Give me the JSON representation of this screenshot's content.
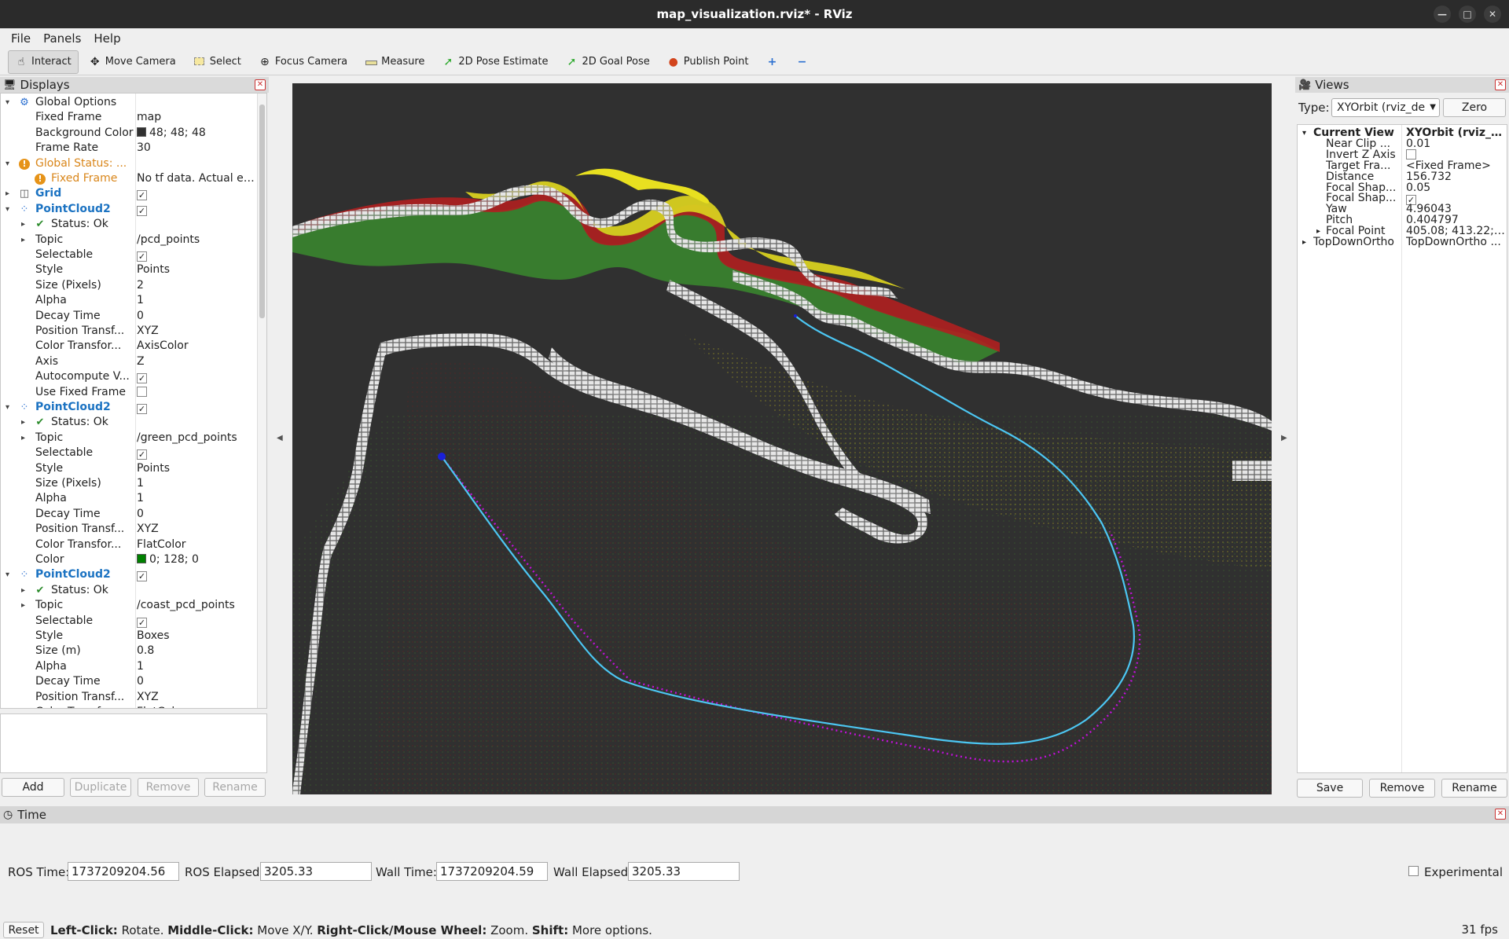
{
  "window": {
    "title": "map_visualization.rviz* - RViz"
  },
  "menu": [
    "File",
    "Panels",
    "Help"
  ],
  "toolbar": [
    {
      "label": "Interact",
      "icon": "cursor-icon"
    },
    {
      "label": "Move Camera",
      "icon": "move-camera-icon"
    },
    {
      "label": "Select",
      "icon": "select-icon"
    },
    {
      "label": "Focus Camera",
      "icon": "focus-camera-icon"
    },
    {
      "label": "Measure",
      "icon": "measure-icon"
    },
    {
      "label": "2D Pose Estimate",
      "icon": "pose-estimate-icon"
    },
    {
      "label": "2D Goal Pose",
      "icon": "goal-pose-icon"
    },
    {
      "label": "Publish Point",
      "icon": "publish-point-icon"
    }
  ],
  "displays": {
    "title": "Displays",
    "rows": [
      {
        "name": "Global Options",
        "value": "",
        "indent": 0,
        "arrow": "down",
        "icon": "gear",
        "style": ""
      },
      {
        "name": "Fixed Frame",
        "value": "map",
        "indent": 1,
        "style": ""
      },
      {
        "name": "Background Color",
        "value": "48; 48; 48",
        "indent": 1,
        "swatch": "#303030",
        "style": ""
      },
      {
        "name": "Frame Rate",
        "value": "30",
        "indent": 1,
        "style": ""
      },
      {
        "name": "Global Status: ...",
        "value": "",
        "indent": 0,
        "arrow": "down",
        "icon": "warn",
        "style": "orange"
      },
      {
        "name": "Fixed Frame",
        "value": "No tf data.  Actual err...",
        "indent": 1,
        "icon": "warn",
        "style": "orange"
      },
      {
        "name": "Grid",
        "value": "",
        "indent": 0,
        "arrow": "right",
        "icon": "grid",
        "style": "blue",
        "check": true
      },
      {
        "name": "PointCloud2",
        "value": "",
        "indent": 0,
        "arrow": "down",
        "icon": "cloud",
        "style": "blue",
        "check": true
      },
      {
        "name": "Status: Ok",
        "value": "",
        "indent": 1,
        "arrow": "right",
        "icon": "ok",
        "style": ""
      },
      {
        "name": "Topic",
        "value": "/pcd_points",
        "indent": 1,
        "arrow": "right",
        "style": ""
      },
      {
        "name": "Selectable",
        "value": "",
        "indent": 1,
        "check": true,
        "style": ""
      },
      {
        "name": "Style",
        "value": "Points",
        "indent": 1,
        "style": ""
      },
      {
        "name": "Size (Pixels)",
        "value": "2",
        "indent": 1,
        "style": ""
      },
      {
        "name": "Alpha",
        "value": "1",
        "indent": 1,
        "style": ""
      },
      {
        "name": "Decay Time",
        "value": "0",
        "indent": 1,
        "style": ""
      },
      {
        "name": "Position Transf...",
        "value": "XYZ",
        "indent": 1,
        "style": ""
      },
      {
        "name": "Color Transfor...",
        "value": "AxisColor",
        "indent": 1,
        "style": ""
      },
      {
        "name": "Axis",
        "value": "Z",
        "indent": 1,
        "style": ""
      },
      {
        "name": "Autocompute V...",
        "value": "",
        "indent": 1,
        "check": true,
        "style": ""
      },
      {
        "name": "Use Fixed Frame",
        "value": "",
        "indent": 1,
        "check": false,
        "style": ""
      },
      {
        "name": "PointCloud2",
        "value": "",
        "indent": 0,
        "arrow": "down",
        "icon": "cloud",
        "style": "blue",
        "check": true
      },
      {
        "name": "Status: Ok",
        "value": "",
        "indent": 1,
        "arrow": "right",
        "icon": "ok",
        "style": ""
      },
      {
        "name": "Topic",
        "value": "/green_pcd_points",
        "indent": 1,
        "arrow": "right",
        "style": ""
      },
      {
        "name": "Selectable",
        "value": "",
        "indent": 1,
        "check": true,
        "style": ""
      },
      {
        "name": "Style",
        "value": "Points",
        "indent": 1,
        "style": ""
      },
      {
        "name": "Size (Pixels)",
        "value": "1",
        "indent": 1,
        "style": ""
      },
      {
        "name": "Alpha",
        "value": "1",
        "indent": 1,
        "style": ""
      },
      {
        "name": "Decay Time",
        "value": "0",
        "indent": 1,
        "style": ""
      },
      {
        "name": "Position Transf...",
        "value": "XYZ",
        "indent": 1,
        "style": ""
      },
      {
        "name": "Color Transfor...",
        "value": "FlatColor",
        "indent": 1,
        "style": ""
      },
      {
        "name": "Color",
        "value": "0; 128; 0",
        "indent": 1,
        "swatch": "#008000",
        "style": ""
      },
      {
        "name": "PointCloud2",
        "value": "",
        "indent": 0,
        "arrow": "down",
        "icon": "cloud",
        "style": "blue",
        "check": true
      },
      {
        "name": "Status: Ok",
        "value": "",
        "indent": 1,
        "arrow": "right",
        "icon": "ok",
        "style": ""
      },
      {
        "name": "Topic",
        "value": "/coast_pcd_points",
        "indent": 1,
        "arrow": "right",
        "style": ""
      },
      {
        "name": "Selectable",
        "value": "",
        "indent": 1,
        "check": true,
        "style": ""
      },
      {
        "name": "Style",
        "value": "Boxes",
        "indent": 1,
        "style": ""
      },
      {
        "name": "Size (m)",
        "value": "0.8",
        "indent": 1,
        "style": ""
      },
      {
        "name": "Alpha",
        "value": "1",
        "indent": 1,
        "style": ""
      },
      {
        "name": "Decay Time",
        "value": "0",
        "indent": 1,
        "style": ""
      },
      {
        "name": "Position Transf...",
        "value": "XYZ",
        "indent": 1,
        "style": ""
      },
      {
        "name": "Color Transfor...",
        "value": "FlatColor",
        "indent": 1,
        "style": ""
      }
    ],
    "buttons": {
      "add": "Add",
      "duplicate": "Duplicate",
      "remove": "Remove",
      "rename": "Rename"
    }
  },
  "views": {
    "title": "Views",
    "type_label": "Type:",
    "type_value": "XYOrbit (rviz_de",
    "zero": "Zero",
    "rows": [
      {
        "name": "Current View",
        "value": "XYOrbit (rviz_d...",
        "arrow": "down",
        "bold": true,
        "indent": 0
      },
      {
        "name": "Near Clip ...",
        "value": "0.01",
        "indent": 1
      },
      {
        "name": "Invert Z Axis",
        "value": "",
        "check": false,
        "indent": 1
      },
      {
        "name": "Target Fra...",
        "value": "<Fixed Frame>",
        "indent": 1
      },
      {
        "name": "Distance",
        "value": "156.732",
        "indent": 1
      },
      {
        "name": "Focal Shap...",
        "value": "0.05",
        "indent": 1
      },
      {
        "name": "Focal Shap...",
        "value": "",
        "check": true,
        "indent": 1
      },
      {
        "name": "Yaw",
        "value": "4.96043",
        "indent": 1
      },
      {
        "name": "Pitch",
        "value": "0.404797",
        "indent": 1
      },
      {
        "name": "Focal Point",
        "value": "405.08; 413.22; ...",
        "arrow": "right",
        "indent": 1
      },
      {
        "name": "TopDownOrtho",
        "value": "TopDownOrtho ...",
        "arrow": "right",
        "indent": 0
      }
    ],
    "buttons": {
      "save": "Save",
      "remove": "Remove",
      "rename": "Rename"
    }
  },
  "time": {
    "title": "Time",
    "ros_time_label": "ROS Time:",
    "ros_time": "1737209204.56",
    "ros_elapsed_label": "ROS Elapsed:",
    "ros_elapsed": "3205.33",
    "wall_time_label": "Wall Time:",
    "wall_time": "1737209204.59",
    "wall_elapsed_label": "Wall Elapsed:",
    "wall_elapsed": "3205.33",
    "experimental": "Experimental"
  },
  "status": {
    "reset": "Reset",
    "left_click": "Left-Click:",
    "left_click_desc": " Rotate. ",
    "middle_click": "Middle-Click:",
    "middle_click_desc": " Move X/Y. ",
    "right_click": "Right-Click/Mouse Wheel:",
    "right_click_desc": " Zoom. ",
    "shift": "Shift:",
    "shift_desc": " More options.",
    "fps": "31 fps"
  },
  "colors": {
    "viewport_bg": "#303030",
    "path_cyan": "#4cc6f2",
    "path_magenta": "#c010d8",
    "coast_boxes": "#e8e8e8"
  }
}
